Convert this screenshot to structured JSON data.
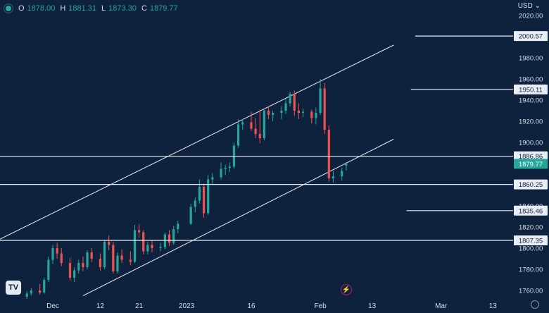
{
  "header": {
    "open_label": "O",
    "open": "1878.00",
    "high_label": "H",
    "high": "1881.31",
    "low_label": "L",
    "low": "1873.30",
    "close_label": "C",
    "close": "1879.77"
  },
  "currency_label": "USD",
  "colors": {
    "background": "#0f223d",
    "up": "#26a69a",
    "down": "#ef5350",
    "lines": "#e8edf3",
    "text": "#d6dde8",
    "last_price_bg": "#26a69a"
  },
  "icons": [
    "tradingview-logo-icon",
    "lightning-icon",
    "chevron-down-icon",
    "gear-icon"
  ],
  "chart_data": {
    "type": "candlestick",
    "title": "",
    "ylim": [
      1755,
      2025
    ],
    "y_ticks": [
      2020,
      2000,
      1980,
      1960,
      1940,
      1920,
      1900,
      1880,
      1860,
      1840,
      1820,
      1800,
      1780,
      1760
    ],
    "y_tick_labels": [
      "2020.00",
      "2000.00",
      "1980.00",
      "1960.00",
      "1940.00",
      "1920.00",
      "1900.00",
      "1880.00",
      "1860.00",
      "1840.00",
      "1820.00",
      "1800.00",
      "1780.00",
      "1760.00"
    ],
    "x_tick_labels": [
      "Dec",
      "12",
      "21",
      "2023",
      "16",
      "Feb",
      "13",
      "Mar",
      "13"
    ],
    "x_tick_dates": [
      "2022-12-01",
      "2022-12-12",
      "2022-12-21",
      "2023-01-01",
      "2023-01-16",
      "2023-02-01",
      "2023-02-13",
      "2023-03-01",
      "2023-03-13"
    ],
    "price_levels": [
      {
        "label": "2000.57",
        "value": 2000.57,
        "line": "partial",
        "line_start": "2023-02-23"
      },
      {
        "label": "1950.11",
        "value": 1950.11,
        "line": "partial",
        "line_start": "2023-02-22"
      },
      {
        "label": "1886.86",
        "value": 1886.86,
        "line": "full"
      },
      {
        "label": "1860.25",
        "value": 1860.25,
        "line": "full"
      },
      {
        "label": "1835.46",
        "value": 1835.46,
        "line": "partial",
        "line_start": "2023-02-21"
      },
      {
        "label": "1807.35",
        "value": 1807.35,
        "line": "full"
      }
    ],
    "last_price": {
      "label": "1879.77",
      "value": 1879.77
    },
    "channel": {
      "upper": [
        {
          "date": "2022-11-15",
          "value": 1801
        },
        {
          "date": "2023-02-18",
          "value": 1992
        }
      ],
      "lower": [
        {
          "date": "2022-12-08",
          "value": 1755
        },
        {
          "date": "2023-02-18",
          "value": 1903
        }
      ]
    },
    "candles": [
      [
        "2022-11-25",
        1754,
        1759,
        1752,
        1757
      ],
      [
        "2022-11-26",
        1757,
        1762,
        1755,
        1760
      ],
      [
        "2022-11-28",
        1760,
        1766,
        1756,
        1758
      ],
      [
        "2022-11-29",
        1758,
        1772,
        1757,
        1770
      ],
      [
        "2022-11-30",
        1770,
        1792,
        1768,
        1789
      ],
      [
        "2022-12-01",
        1789,
        1803,
        1785,
        1800
      ],
      [
        "2022-12-02",
        1800,
        1805,
        1790,
        1795
      ],
      [
        "2022-12-03",
        1795,
        1800,
        1783,
        1786
      ],
      [
        "2022-12-05",
        1786,
        1791,
        1769,
        1772
      ],
      [
        "2022-12-06",
        1772,
        1782,
        1768,
        1779
      ],
      [
        "2022-12-07",
        1779,
        1789,
        1776,
        1786
      ],
      [
        "2022-12-08",
        1786,
        1792,
        1778,
        1782
      ],
      [
        "2022-12-09",
        1782,
        1798,
        1780,
        1796
      ],
      [
        "2022-12-10",
        1796,
        1800,
        1787,
        1790
      ],
      [
        "2022-12-12",
        1790,
        1795,
        1779,
        1782
      ],
      [
        "2022-12-13",
        1782,
        1808,
        1780,
        1806
      ],
      [
        "2022-12-14",
        1806,
        1812,
        1798,
        1803
      ],
      [
        "2022-12-15",
        1803,
        1806,
        1776,
        1778
      ],
      [
        "2022-12-16",
        1778,
        1796,
        1776,
        1793
      ],
      [
        "2022-12-17",
        1793,
        1799,
        1786,
        1789
      ],
      [
        "2022-12-19",
        1789,
        1797,
        1784,
        1787
      ],
      [
        "2022-12-20",
        1787,
        1822,
        1786,
        1817
      ],
      [
        "2022-12-21",
        1817,
        1823,
        1810,
        1815
      ],
      [
        "2022-12-22",
        1815,
        1817,
        1794,
        1797
      ],
      [
        "2022-12-23",
        1797,
        1806,
        1794,
        1803
      ],
      [
        "2022-12-24",
        1803,
        1807,
        1796,
        1800
      ],
      [
        "2022-12-26",
        1800,
        1805,
        1797,
        1801
      ],
      [
        "2022-12-27",
        1801,
        1815,
        1799,
        1813
      ],
      [
        "2022-12-28",
        1813,
        1817,
        1802,
        1805
      ],
      [
        "2022-12-29",
        1805,
        1821,
        1803,
        1818
      ],
      [
        "2022-12-30",
        1818,
        1826,
        1814,
        1823
      ],
      [
        "2023-01-02",
        1823,
        1842,
        1822,
        1839
      ],
      [
        "2023-01-03",
        1839,
        1848,
        1834,
        1845
      ],
      [
        "2023-01-04",
        1845,
        1865,
        1842,
        1858
      ],
      [
        "2023-01-05",
        1858,
        1861,
        1829,
        1833
      ],
      [
        "2023-01-06",
        1833,
        1869,
        1831,
        1865
      ],
      [
        "2023-01-07",
        1865,
        1871,
        1860,
        1867
      ],
      [
        "2023-01-09",
        1867,
        1881,
        1865,
        1875
      ],
      [
        "2023-01-10",
        1875,
        1879,
        1869,
        1876
      ],
      [
        "2023-01-11",
        1876,
        1881,
        1872,
        1877
      ],
      [
        "2023-01-12",
        1877,
        1900,
        1875,
        1897
      ],
      [
        "2023-01-13",
        1897,
        1922,
        1895,
        1917
      ],
      [
        "2023-01-14",
        1917,
        1922,
        1912,
        1919
      ],
      [
        "2023-01-16",
        1919,
        1929,
        1911,
        1913
      ],
      [
        "2023-01-17",
        1913,
        1923,
        1904,
        1908
      ],
      [
        "2023-01-18",
        1908,
        1931,
        1899,
        1904
      ],
      [
        "2023-01-19",
        1904,
        1932,
        1902,
        1930
      ],
      [
        "2023-01-20",
        1930,
        1934,
        1922,
        1926
      ],
      [
        "2023-01-21",
        1926,
        1930,
        1920,
        1928
      ],
      [
        "2023-01-23",
        1928,
        1934,
        1922,
        1930
      ],
      [
        "2023-01-24",
        1930,
        1941,
        1927,
        1937
      ],
      [
        "2023-01-25",
        1937,
        1948,
        1934,
        1946
      ],
      [
        "2023-01-26",
        1946,
        1949,
        1925,
        1930
      ],
      [
        "2023-01-27",
        1930,
        1937,
        1922,
        1928
      ],
      [
        "2023-01-28",
        1928,
        1932,
        1924,
        1929
      ],
      [
        "2023-01-30",
        1929,
        1931,
        1918,
        1923
      ],
      [
        "2023-01-31",
        1923,
        1933,
        1917,
        1928
      ],
      [
        "2023-02-01",
        1928,
        1960,
        1926,
        1951
      ],
      [
        "2023-02-02",
        1951,
        1956,
        1908,
        1912
      ],
      [
        "2023-02-03",
        1912,
        1916,
        1863,
        1866
      ],
      [
        "2023-02-04",
        1866,
        1873,
        1862,
        1868
      ],
      [
        "2023-02-06",
        1868,
        1876,
        1864,
        1873
      ],
      [
        "2023-02-07",
        1878,
        1881.31,
        1873.3,
        1879.77
      ]
    ]
  }
}
